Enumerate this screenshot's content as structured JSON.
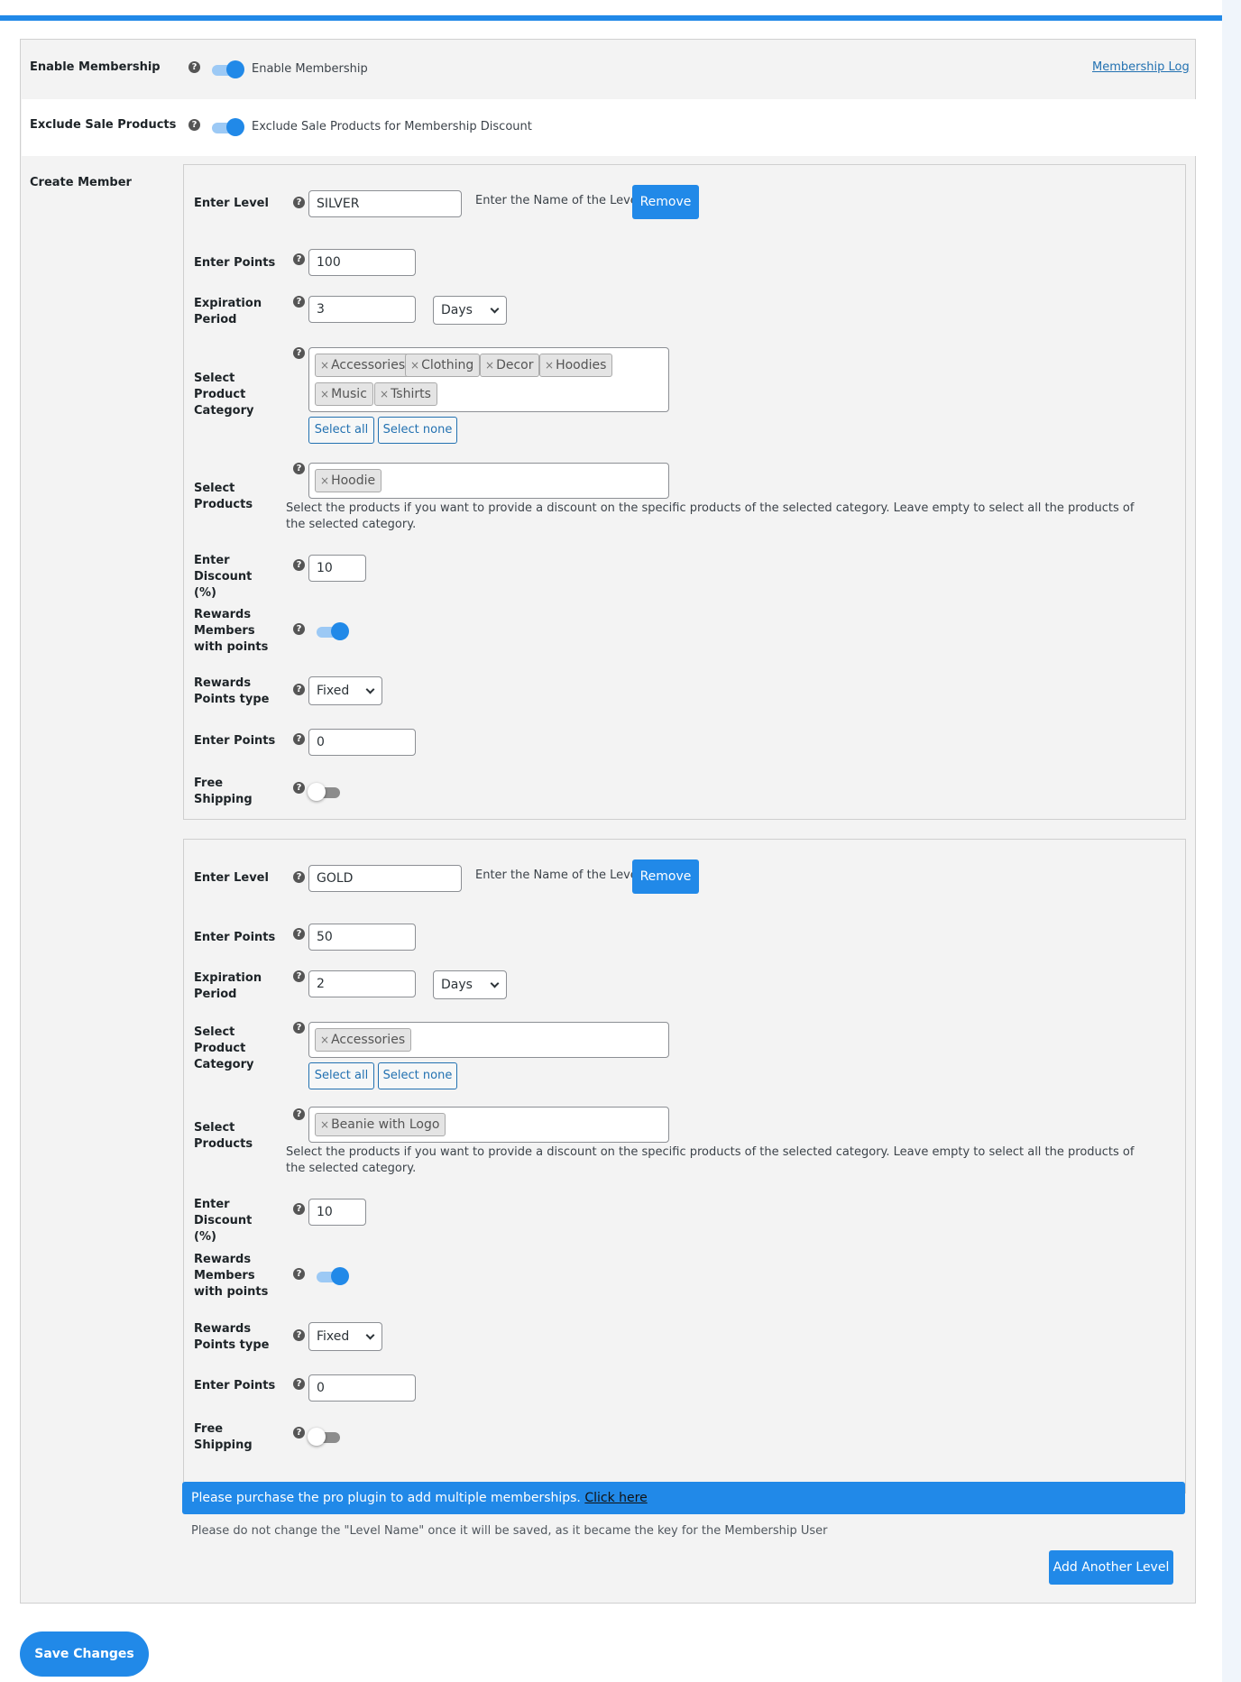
{
  "membership_log": "Membership Log",
  "settings": [
    {
      "label": "Enable Membership",
      "toggle_text": "Enable Membership",
      "on": true
    },
    {
      "label": "Exclude Sale Products",
      "toggle_text": "Exclude Sale Products for Membership Discount",
      "on": true
    }
  ],
  "create_member_label": "Create Member",
  "help_glyph": "?",
  "chip_close": "×",
  "field_labels": {
    "level": "Enter Level",
    "points": "Enter Points",
    "expiration": "Expiration Period",
    "category": "Select Product Category",
    "products": "Select Products",
    "discount": "Enter Discount (%)",
    "rewards": "Rewards Members with points",
    "points_type": "Rewards Points type",
    "enter_points": "Enter Points",
    "free_shipping": "Free Shipping"
  },
  "level_hint": "Enter the Name of the Level",
  "remove_label": "Remove",
  "select_all": "Select all",
  "select_none": "Select none",
  "products_hint": "Select the products if you want to provide a discount on the specific products of the selected category. Leave empty to select all the products of the selected category.",
  "levels": [
    {
      "name": "SILVER",
      "points": "100",
      "expiration_value": "3",
      "expiration_unit": "Days",
      "categories": [
        "Accessories",
        "Clothing",
        "Decor",
        "Hoodies",
        "Music",
        "Tshirts"
      ],
      "products": [
        "Hoodie"
      ],
      "discount": "10",
      "rewards_on": true,
      "points_type": "Fixed",
      "reward_points": "0",
      "free_shipping_on": false
    },
    {
      "name": "GOLD",
      "points": "50",
      "expiration_value": "2",
      "expiration_unit": "Days",
      "categories": [
        "Accessories"
      ],
      "products": [
        "Beanie with Logo"
      ],
      "discount": "10",
      "rewards_on": true,
      "points_type": "Fixed",
      "reward_points": "0",
      "free_shipping_on": false
    }
  ],
  "promo": {
    "text": "Please purchase the pro plugin to add multiple memberships.",
    "link": "Click here"
  },
  "note": "Please do not change the \"Level Name\" once it will be saved, as it became the key for the Membership User",
  "add_level_label": "Add Another Level",
  "save_label": "Save Changes",
  "colors": {
    "accent": "#2189e8",
    "link": "#2271b1",
    "panel": "#f3f3f3"
  }
}
